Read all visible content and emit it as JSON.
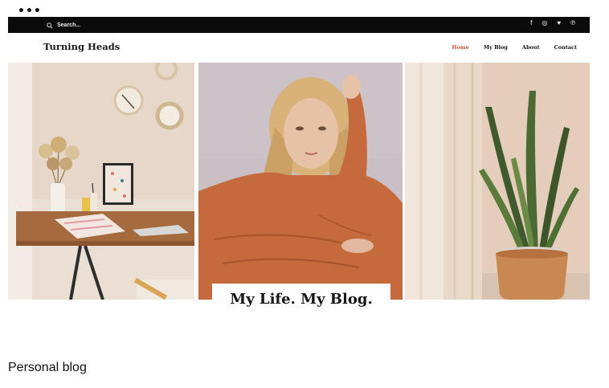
{
  "menu": {
    "dots": "•••"
  },
  "site": {
    "search_label": "Search...",
    "social": [
      "f",
      "◎",
      "♥",
      "℗"
    ],
    "brand": "Turning Heads",
    "nav": [
      {
        "label": "Home",
        "active": true
      },
      {
        "label": "My Blog",
        "active": false
      },
      {
        "label": "About",
        "active": false
      },
      {
        "label": "Contact",
        "active": false
      }
    ],
    "hero_title": "My Life. My Blog."
  },
  "caption": "Personal blog",
  "colors": {
    "bar": "#0b0b0b",
    "accent": "#c0553a",
    "sweater": "#c46a3c",
    "pot": "#c98752"
  }
}
